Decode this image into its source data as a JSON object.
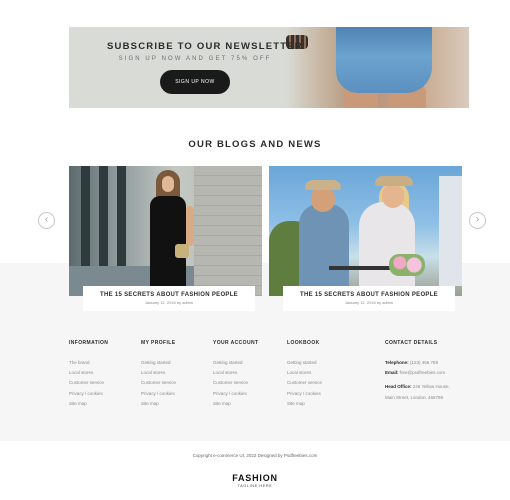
{
  "newsletter": {
    "title": "SUBSCRIBE TO OUR NEWSLETTER",
    "subtitle": "SIGN UP NOW AND GET 75% OFF",
    "button_label": "SIGN UP NOW"
  },
  "blog": {
    "title": "OUR BLOGS AND NEWS",
    "posts": [
      {
        "title": "THE 15 SECRETS ABOUT FASHION PEOPLE",
        "meta": "January 12, 2015 by admin"
      },
      {
        "title": "THE 15 SECRETS ABOUT FASHION PEOPLE",
        "meta": "January 12, 2015 by admin"
      }
    ],
    "prev_glyph": "‹",
    "next_glyph": "›"
  },
  "footer": {
    "columns": [
      {
        "heading": "INFORMATION",
        "links": [
          "The brand",
          "Local stores",
          "Customer service",
          "Privacy / cookies",
          "Site map"
        ]
      },
      {
        "heading": "MY PROFILE",
        "links": [
          "Getting started",
          "Local stores",
          "Customer service",
          "Privacy / cookies",
          "Site map"
        ]
      },
      {
        "heading": "YOUR ACCOUNT",
        "links": [
          "Getting started",
          "Local stores",
          "Customer service",
          "Privacy / cookies",
          "Site map"
        ]
      },
      {
        "heading": "LOOKBOOK",
        "links": [
          "Getting started",
          "Local stores",
          "Customer service",
          "Privacy / cookies",
          "Site map"
        ]
      }
    ],
    "contact": {
      "heading": "CONTACT DETAILS",
      "telephone_label": "Telephone:",
      "telephone": "(123) 456 789",
      "email_label": "Email:",
      "email": "free@psdfreebies.com",
      "office_label": "Head Office:",
      "office_line1": "246 Yellow House,",
      "office_line2": "Main Street, London, 456789"
    },
    "copyright": "Copyright e-commerce UI, 2022 Designed by Psdfreebies.com",
    "logo": "FASHION",
    "tagline": "TAGLINE HERE"
  }
}
